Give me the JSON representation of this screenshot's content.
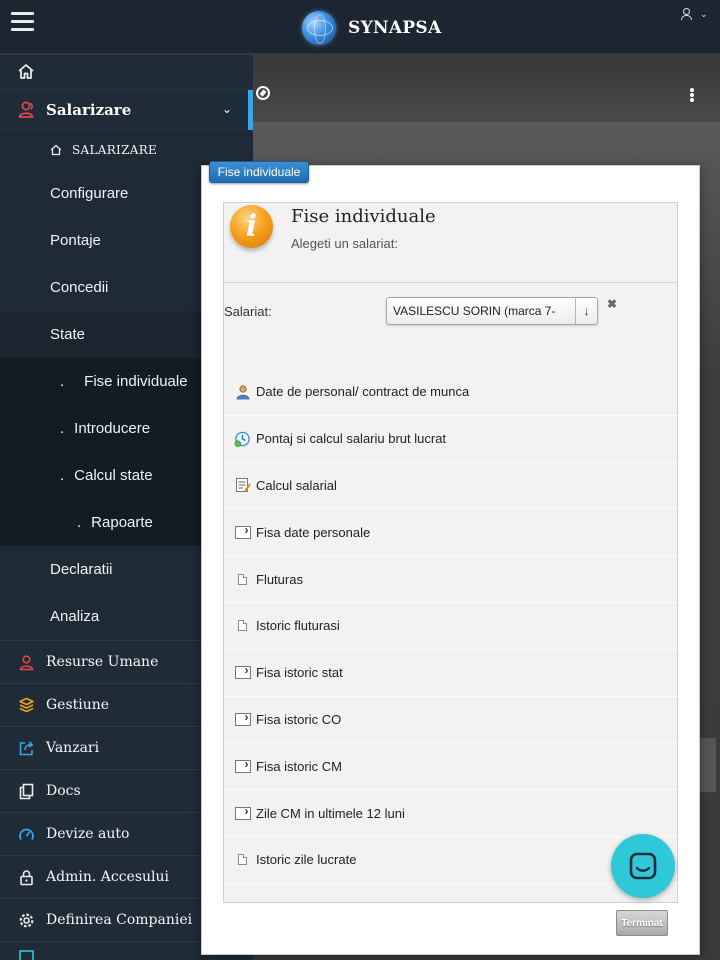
{
  "app": {
    "brand": "SYNAPSA"
  },
  "sidebar": {
    "section": {
      "label": "Salarizare",
      "items": [
        {
          "label": "SALARIZARE"
        },
        {
          "label": "Configurare"
        },
        {
          "label": "Pontaje"
        },
        {
          "label": "Concedii"
        },
        {
          "label": "State"
        }
      ],
      "state_children": [
        {
          "label": "Fise individuale"
        },
        {
          "label": "Introducere"
        },
        {
          "label": "Calcul state"
        },
        {
          "label": "Rapoarte"
        }
      ],
      "after_items": [
        {
          "label": "Declaratii"
        },
        {
          "label": "Analiza"
        }
      ]
    },
    "modules": [
      {
        "label": "Resurse Umane",
        "icon": "user-icon"
      },
      {
        "label": "Gestiune",
        "icon": "boxes-icon"
      },
      {
        "label": "Vanzari",
        "icon": "share-icon"
      },
      {
        "label": "Docs",
        "icon": "copy-icon"
      },
      {
        "label": "Devize auto",
        "icon": "speedometer-icon"
      },
      {
        "label": "Admin. Accesului",
        "icon": "lock-icon"
      },
      {
        "label": "Definirea Companiei",
        "icon": "gear-icon"
      }
    ]
  },
  "modal": {
    "tab_label": "Fise individuale",
    "title": "Fise individuale",
    "subtitle": "Alegeti un salariat:",
    "salariat_label": "Salariat:",
    "salariat_value": "VASILESCU SORIN (marca 7-",
    "clear_symbol": "✖",
    "links": [
      {
        "label": "Date de personal/ contract de munca",
        "icon": "person-icon"
      },
      {
        "label": "Pontaj si calcul salariu brut lucrat",
        "icon": "clock-icon"
      },
      {
        "label": "Calcul salarial",
        "icon": "calculator-icon"
      },
      {
        "label": "Fisa date personale",
        "icon": "document-arrow-icon"
      },
      {
        "label": "Fluturas",
        "icon": "document-icon"
      },
      {
        "label": "Istoric fluturasi",
        "icon": "document-icon"
      },
      {
        "label": "Fisa istoric stat",
        "icon": "document-arrow-icon"
      },
      {
        "label": "Fisa istoric CO",
        "icon": "document-arrow-icon"
      },
      {
        "label": "Fisa istoric CM",
        "icon": "document-arrow-icon"
      },
      {
        "label": "Zile CM in ultimele 12 luni",
        "icon": "document-arrow-icon"
      },
      {
        "label": "Istoric zile lucrate",
        "icon": "document-icon"
      }
    ],
    "done_label": "Terminat"
  },
  "colors": {
    "sidebar_bg": "#1f2b36",
    "accent_blue": "#3ba6e6",
    "module_icon_red": "#e0444c",
    "module_icon_orange": "#f0a020",
    "module_icon_blue": "#3ba6e6",
    "chat_teal": "#2ec9d9"
  }
}
